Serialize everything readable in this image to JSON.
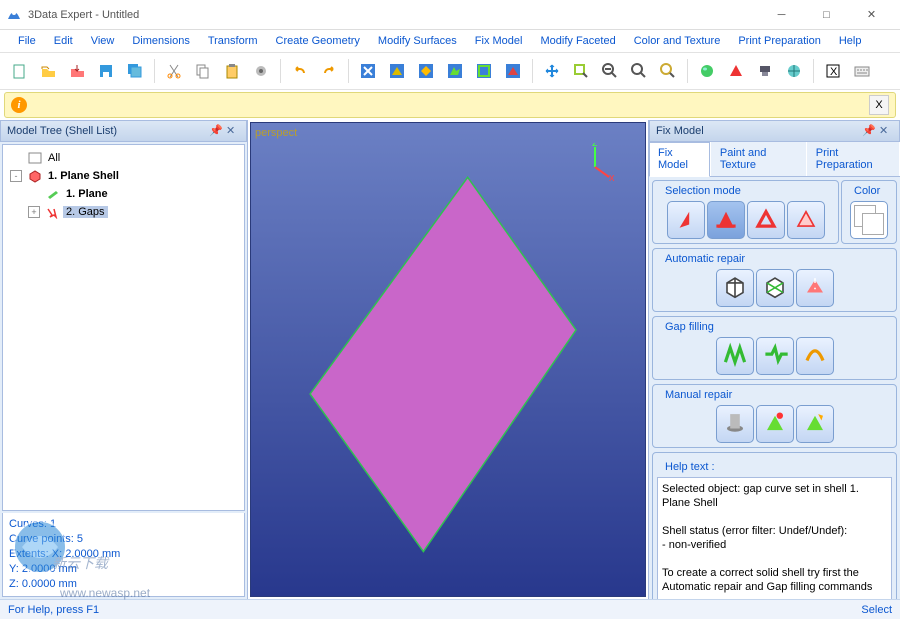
{
  "window": {
    "title": "3Data Expert - Untitled"
  },
  "menu": [
    "File",
    "Edit",
    "View",
    "Dimensions",
    "Transform",
    "Create Geometry",
    "Modify Surfaces",
    "Fix Model",
    "Modify Faceted",
    "Color and Texture",
    "Print Preparation",
    "Help"
  ],
  "toolbar_icons": [
    "new",
    "open",
    "load",
    "save",
    "saveall",
    "cut",
    "copy",
    "paste",
    "gear",
    "undo",
    "redo",
    "mode-x",
    "mode-a",
    "mode-b",
    "mode-c",
    "mode-d",
    "mode-e",
    "cross",
    "zoom-win",
    "zoom-out",
    "zoom",
    "zoom-reset",
    "sphere",
    "triangle",
    "print-head",
    "globe",
    "x-box",
    "kbd"
  ],
  "left": {
    "title": "Model Tree (Shell List)",
    "items": [
      {
        "label": "All",
        "icon": "all",
        "depth": 0,
        "exp": ""
      },
      {
        "label": "1. Plane Shell",
        "icon": "shell",
        "depth": 0,
        "exp": "-",
        "bold": true
      },
      {
        "label": "1. Plane",
        "icon": "plane",
        "depth": 1,
        "exp": "",
        "bold": true
      },
      {
        "label": "2. Gaps",
        "icon": "gaps",
        "depth": 1,
        "exp": "+",
        "selected": true
      }
    ],
    "footer": [
      "Curves: 1",
      "Curve points: 5",
      "Extents:   X: 2.0000 mm",
      "                Y: 2.0000 mm",
      "                Z: 0.0000 mm"
    ]
  },
  "viewport": {
    "label": "perspect"
  },
  "right": {
    "title": "Fix Model",
    "tabs": [
      "Fix Model",
      "Paint and Texture",
      "Print Preparation"
    ],
    "active_tab": 0,
    "groups": {
      "selection": {
        "title": "Selection mode",
        "buttons": [
          "sel-a",
          "sel-b",
          "sel-c",
          "sel-d"
        ]
      },
      "color": {
        "title": "Color"
      },
      "auto": {
        "title": "Automatic repair",
        "buttons": [
          "auto-a",
          "auto-b",
          "auto-c"
        ]
      },
      "gap": {
        "title": "Gap filling",
        "buttons": [
          "gap-a",
          "gap-b",
          "gap-c"
        ]
      },
      "manual": {
        "title": "Manual repair",
        "buttons": [
          "man-a",
          "man-b",
          "man-c"
        ]
      },
      "help": {
        "title": "Help text :",
        "text": "Selected object: gap curve set in shell 1. Plane Shell\n\nShell status (error filter: Undef/Undef):\n- non-verified\n\nTo create a correct solid shell try first the Automatic repair and Gap filling commands"
      }
    }
  },
  "status": {
    "left": "For Help, press F1",
    "right": "Select"
  },
  "watermark": {
    "url": "www.newasp.net",
    "text": "新云下载"
  }
}
